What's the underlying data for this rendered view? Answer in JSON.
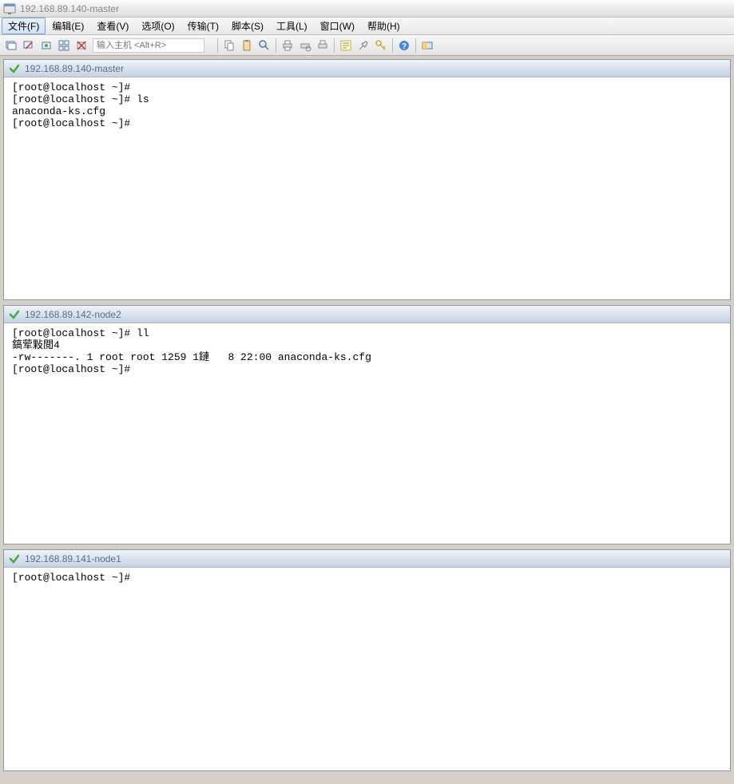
{
  "window": {
    "title": "192.168.89.140-master"
  },
  "menu": {
    "file": "文件(F)",
    "edit": "编辑(E)",
    "view": "查看(V)",
    "options": "选项(O)",
    "transfer": "传输(T)",
    "script": "脚本(S)",
    "tools": "工具(L)",
    "window": "窗口(W)",
    "help": "帮助(H)"
  },
  "toolbar": {
    "host_placeholder": "输入主机 <Alt+R>"
  },
  "panels": [
    {
      "title": "192.168.89.140-master",
      "content": "[root@localhost ~]# \n[root@localhost ~]# ls\nanaconda-ks.cfg\n[root@localhost ~]# "
    },
    {
      "title": "192.168.89.142-node2",
      "content": "[root@localhost ~]# ll\n鎬荤敤閲4\n-rw-------. 1 root root 1259 1鏈   8 22:00 anaconda-ks.cfg\n[root@localhost ~]# "
    },
    {
      "title": "192.168.89.141-node1",
      "content": "[root@localhost ~]# "
    }
  ]
}
